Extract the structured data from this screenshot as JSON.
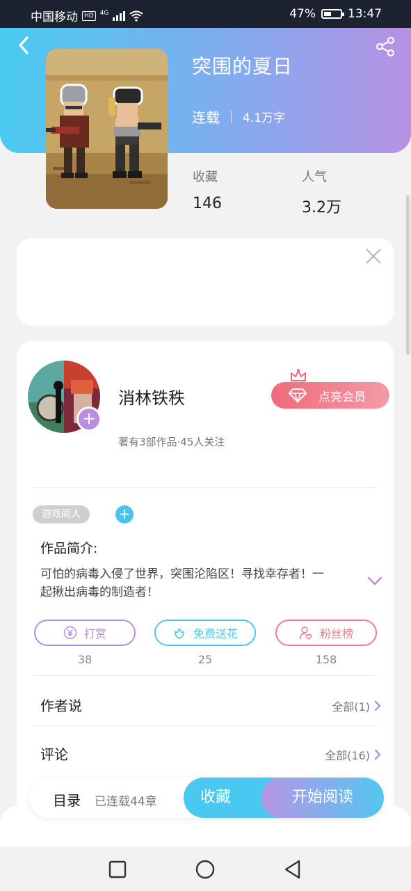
{
  "status_bar": {
    "carrier": "中国移动",
    "hd_label": "HD",
    "network": "4G",
    "battery": "47%",
    "battery_level": 0.47,
    "time": "13:47"
  },
  "book": {
    "title": "突围的夏日",
    "status": "连载",
    "word_count": "4.1万字",
    "stats": [
      {
        "label": "收藏",
        "value": "146"
      },
      {
        "label": "人气",
        "value": "3.2万"
      }
    ]
  },
  "author": {
    "name": "消林铁秩",
    "summary": "著有3部作品·45人关注",
    "vip_label": "点亮会员"
  },
  "tags": [
    "游戏同人"
  ],
  "intro": {
    "heading": "作品简介:",
    "text": "可怕的病毒入侵了世界，突围沦陷区！寻找幸存者！一起揪出病毒的制造者！"
  },
  "actions": [
    {
      "label": "打赏",
      "count": "38",
      "icon": "yuan-icon",
      "color": "#b690e0"
    },
    {
      "label": "免费送花",
      "count": "25",
      "icon": "flower-icon",
      "color": "#4cc8ec"
    },
    {
      "label": "粉丝榜",
      "count": "158",
      "icon": "fan-icon",
      "color": "#ee7f86"
    }
  ],
  "sections": [
    {
      "label": "作者说",
      "more": "全部(1)"
    },
    {
      "label": "评论",
      "more": "全部(16)"
    }
  ],
  "bottom_bar": {
    "toc": "目录",
    "chapters": "已连载44章",
    "collect": "收藏",
    "read": "开始阅读"
  },
  "colors": {
    "header_start": "#49cbf0",
    "header_end": "#b792e3",
    "accent_blue": "#49c8f2",
    "accent_purple": "#b88fe0",
    "vip_red": "#f06b7b"
  }
}
